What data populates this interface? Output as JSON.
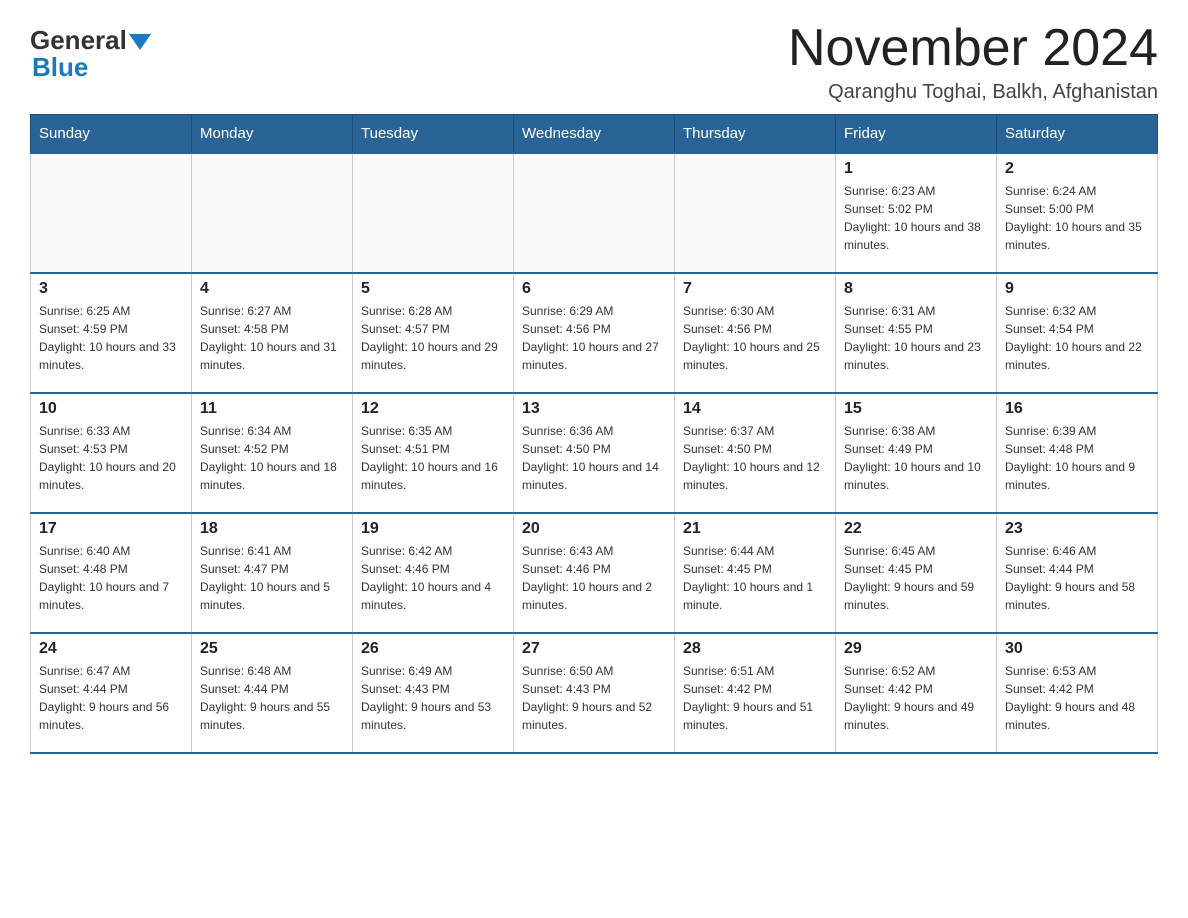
{
  "header": {
    "logo_general": "General",
    "logo_blue": "Blue",
    "title": "November 2024",
    "location": "Qaranghu Toghai, Balkh, Afghanistan"
  },
  "days_of_week": [
    "Sunday",
    "Monday",
    "Tuesday",
    "Wednesday",
    "Thursday",
    "Friday",
    "Saturday"
  ],
  "weeks": [
    [
      {
        "day": "",
        "info": ""
      },
      {
        "day": "",
        "info": ""
      },
      {
        "day": "",
        "info": ""
      },
      {
        "day": "",
        "info": ""
      },
      {
        "day": "",
        "info": ""
      },
      {
        "day": "1",
        "info": "Sunrise: 6:23 AM\nSunset: 5:02 PM\nDaylight: 10 hours and 38 minutes."
      },
      {
        "day": "2",
        "info": "Sunrise: 6:24 AM\nSunset: 5:00 PM\nDaylight: 10 hours and 35 minutes."
      }
    ],
    [
      {
        "day": "3",
        "info": "Sunrise: 6:25 AM\nSunset: 4:59 PM\nDaylight: 10 hours and 33 minutes."
      },
      {
        "day": "4",
        "info": "Sunrise: 6:27 AM\nSunset: 4:58 PM\nDaylight: 10 hours and 31 minutes."
      },
      {
        "day": "5",
        "info": "Sunrise: 6:28 AM\nSunset: 4:57 PM\nDaylight: 10 hours and 29 minutes."
      },
      {
        "day": "6",
        "info": "Sunrise: 6:29 AM\nSunset: 4:56 PM\nDaylight: 10 hours and 27 minutes."
      },
      {
        "day": "7",
        "info": "Sunrise: 6:30 AM\nSunset: 4:56 PM\nDaylight: 10 hours and 25 minutes."
      },
      {
        "day": "8",
        "info": "Sunrise: 6:31 AM\nSunset: 4:55 PM\nDaylight: 10 hours and 23 minutes."
      },
      {
        "day": "9",
        "info": "Sunrise: 6:32 AM\nSunset: 4:54 PM\nDaylight: 10 hours and 22 minutes."
      }
    ],
    [
      {
        "day": "10",
        "info": "Sunrise: 6:33 AM\nSunset: 4:53 PM\nDaylight: 10 hours and 20 minutes."
      },
      {
        "day": "11",
        "info": "Sunrise: 6:34 AM\nSunset: 4:52 PM\nDaylight: 10 hours and 18 minutes."
      },
      {
        "day": "12",
        "info": "Sunrise: 6:35 AM\nSunset: 4:51 PM\nDaylight: 10 hours and 16 minutes."
      },
      {
        "day": "13",
        "info": "Sunrise: 6:36 AM\nSunset: 4:50 PM\nDaylight: 10 hours and 14 minutes."
      },
      {
        "day": "14",
        "info": "Sunrise: 6:37 AM\nSunset: 4:50 PM\nDaylight: 10 hours and 12 minutes."
      },
      {
        "day": "15",
        "info": "Sunrise: 6:38 AM\nSunset: 4:49 PM\nDaylight: 10 hours and 10 minutes."
      },
      {
        "day": "16",
        "info": "Sunrise: 6:39 AM\nSunset: 4:48 PM\nDaylight: 10 hours and 9 minutes."
      }
    ],
    [
      {
        "day": "17",
        "info": "Sunrise: 6:40 AM\nSunset: 4:48 PM\nDaylight: 10 hours and 7 minutes."
      },
      {
        "day": "18",
        "info": "Sunrise: 6:41 AM\nSunset: 4:47 PM\nDaylight: 10 hours and 5 minutes."
      },
      {
        "day": "19",
        "info": "Sunrise: 6:42 AM\nSunset: 4:46 PM\nDaylight: 10 hours and 4 minutes."
      },
      {
        "day": "20",
        "info": "Sunrise: 6:43 AM\nSunset: 4:46 PM\nDaylight: 10 hours and 2 minutes."
      },
      {
        "day": "21",
        "info": "Sunrise: 6:44 AM\nSunset: 4:45 PM\nDaylight: 10 hours and 1 minute."
      },
      {
        "day": "22",
        "info": "Sunrise: 6:45 AM\nSunset: 4:45 PM\nDaylight: 9 hours and 59 minutes."
      },
      {
        "day": "23",
        "info": "Sunrise: 6:46 AM\nSunset: 4:44 PM\nDaylight: 9 hours and 58 minutes."
      }
    ],
    [
      {
        "day": "24",
        "info": "Sunrise: 6:47 AM\nSunset: 4:44 PM\nDaylight: 9 hours and 56 minutes."
      },
      {
        "day": "25",
        "info": "Sunrise: 6:48 AM\nSunset: 4:44 PM\nDaylight: 9 hours and 55 minutes."
      },
      {
        "day": "26",
        "info": "Sunrise: 6:49 AM\nSunset: 4:43 PM\nDaylight: 9 hours and 53 minutes."
      },
      {
        "day": "27",
        "info": "Sunrise: 6:50 AM\nSunset: 4:43 PM\nDaylight: 9 hours and 52 minutes."
      },
      {
        "day": "28",
        "info": "Sunrise: 6:51 AM\nSunset: 4:42 PM\nDaylight: 9 hours and 51 minutes."
      },
      {
        "day": "29",
        "info": "Sunrise: 6:52 AM\nSunset: 4:42 PM\nDaylight: 9 hours and 49 minutes."
      },
      {
        "day": "30",
        "info": "Sunrise: 6:53 AM\nSunset: 4:42 PM\nDaylight: 9 hours and 48 minutes."
      }
    ]
  ]
}
